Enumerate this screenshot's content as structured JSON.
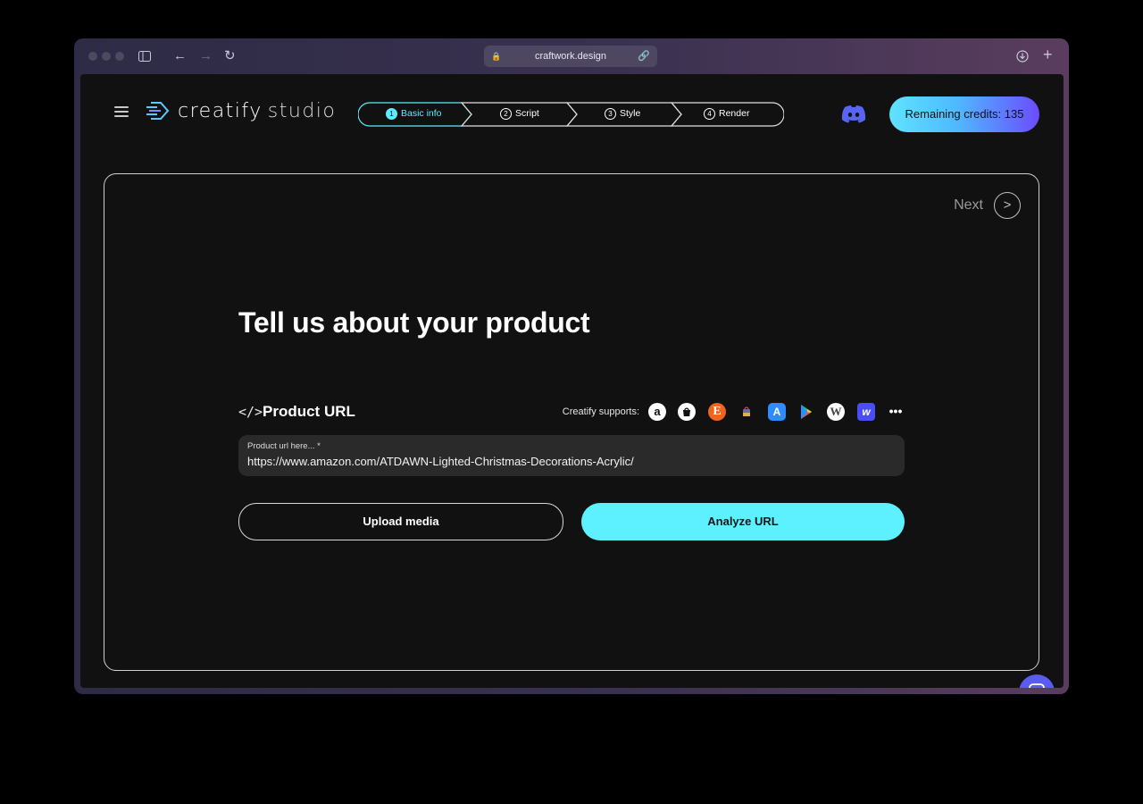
{
  "browser": {
    "url": "craftwork.design"
  },
  "header": {
    "logo_word": "creatify",
    "logo_suffix": "studio",
    "steps": [
      {
        "num": "1",
        "label": "Basic info"
      },
      {
        "num": "2",
        "label": "Script"
      },
      {
        "num": "3",
        "label": "Style"
      },
      {
        "num": "4",
        "label": "Render"
      }
    ],
    "credits_label": "Remaining credits: 135"
  },
  "main": {
    "next_label": "Next",
    "headline": "Tell us about your product",
    "url_section_label": "Product URL",
    "supports_label": "Creatify supports:",
    "supported_platforms": [
      "Amazon",
      "Shopify",
      "Etsy",
      "Shop",
      "App Store",
      "Google Play",
      "WordPress",
      "Wix",
      "More"
    ],
    "input_placeholder": "Product url here... *",
    "input_value": "https://www.amazon.com/ATDAWN-Lighted-Christmas-Decorations-Acrylic/",
    "upload_label": "Upload media",
    "analyze_label": "Analyze URL"
  },
  "colors": {
    "accent": "#5df0ff",
    "credits_gradient_end": "#6a4cff",
    "page_bg": "#111111"
  }
}
